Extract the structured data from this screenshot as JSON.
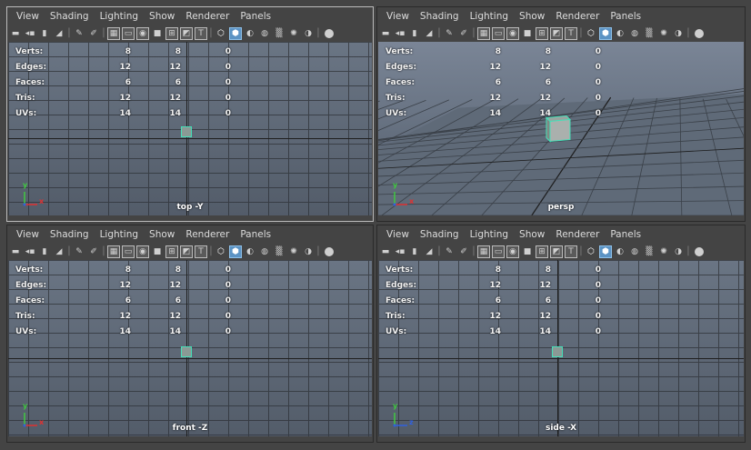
{
  "menu": [
    "View",
    "Shading",
    "Lighting",
    "Show",
    "Renderer",
    "Panels"
  ],
  "stats_rows": [
    {
      "label": "Verts:",
      "c1": "8",
      "c2": "8",
      "c3": "0"
    },
    {
      "label": "Edges:",
      "c1": "12",
      "c2": "12",
      "c3": "0"
    },
    {
      "label": "Faces:",
      "c1": "6",
      "c2": "6",
      "c3": "0"
    },
    {
      "label": "Tris:",
      "c1": "12",
      "c2": "12",
      "c3": "0"
    },
    {
      "label": "UVs:",
      "c1": "14",
      "c2": "14",
      "c3": "0"
    }
  ],
  "panels": [
    {
      "id": "top",
      "camera": "top -Y",
      "axes": [
        "y",
        "x"
      ]
    },
    {
      "id": "persp",
      "camera": "persp",
      "axes": [
        "y",
        "x"
      ]
    },
    {
      "id": "front",
      "camera": "front -Z",
      "axes": [
        "y",
        "x"
      ]
    },
    {
      "id": "side",
      "camera": "side -X",
      "axes": [
        "y",
        "z"
      ]
    }
  ],
  "colors": {
    "selection": "#45e0b8",
    "axis_x": "#e03030",
    "axis_y": "#40c840",
    "axis_z": "#3060e0"
  }
}
